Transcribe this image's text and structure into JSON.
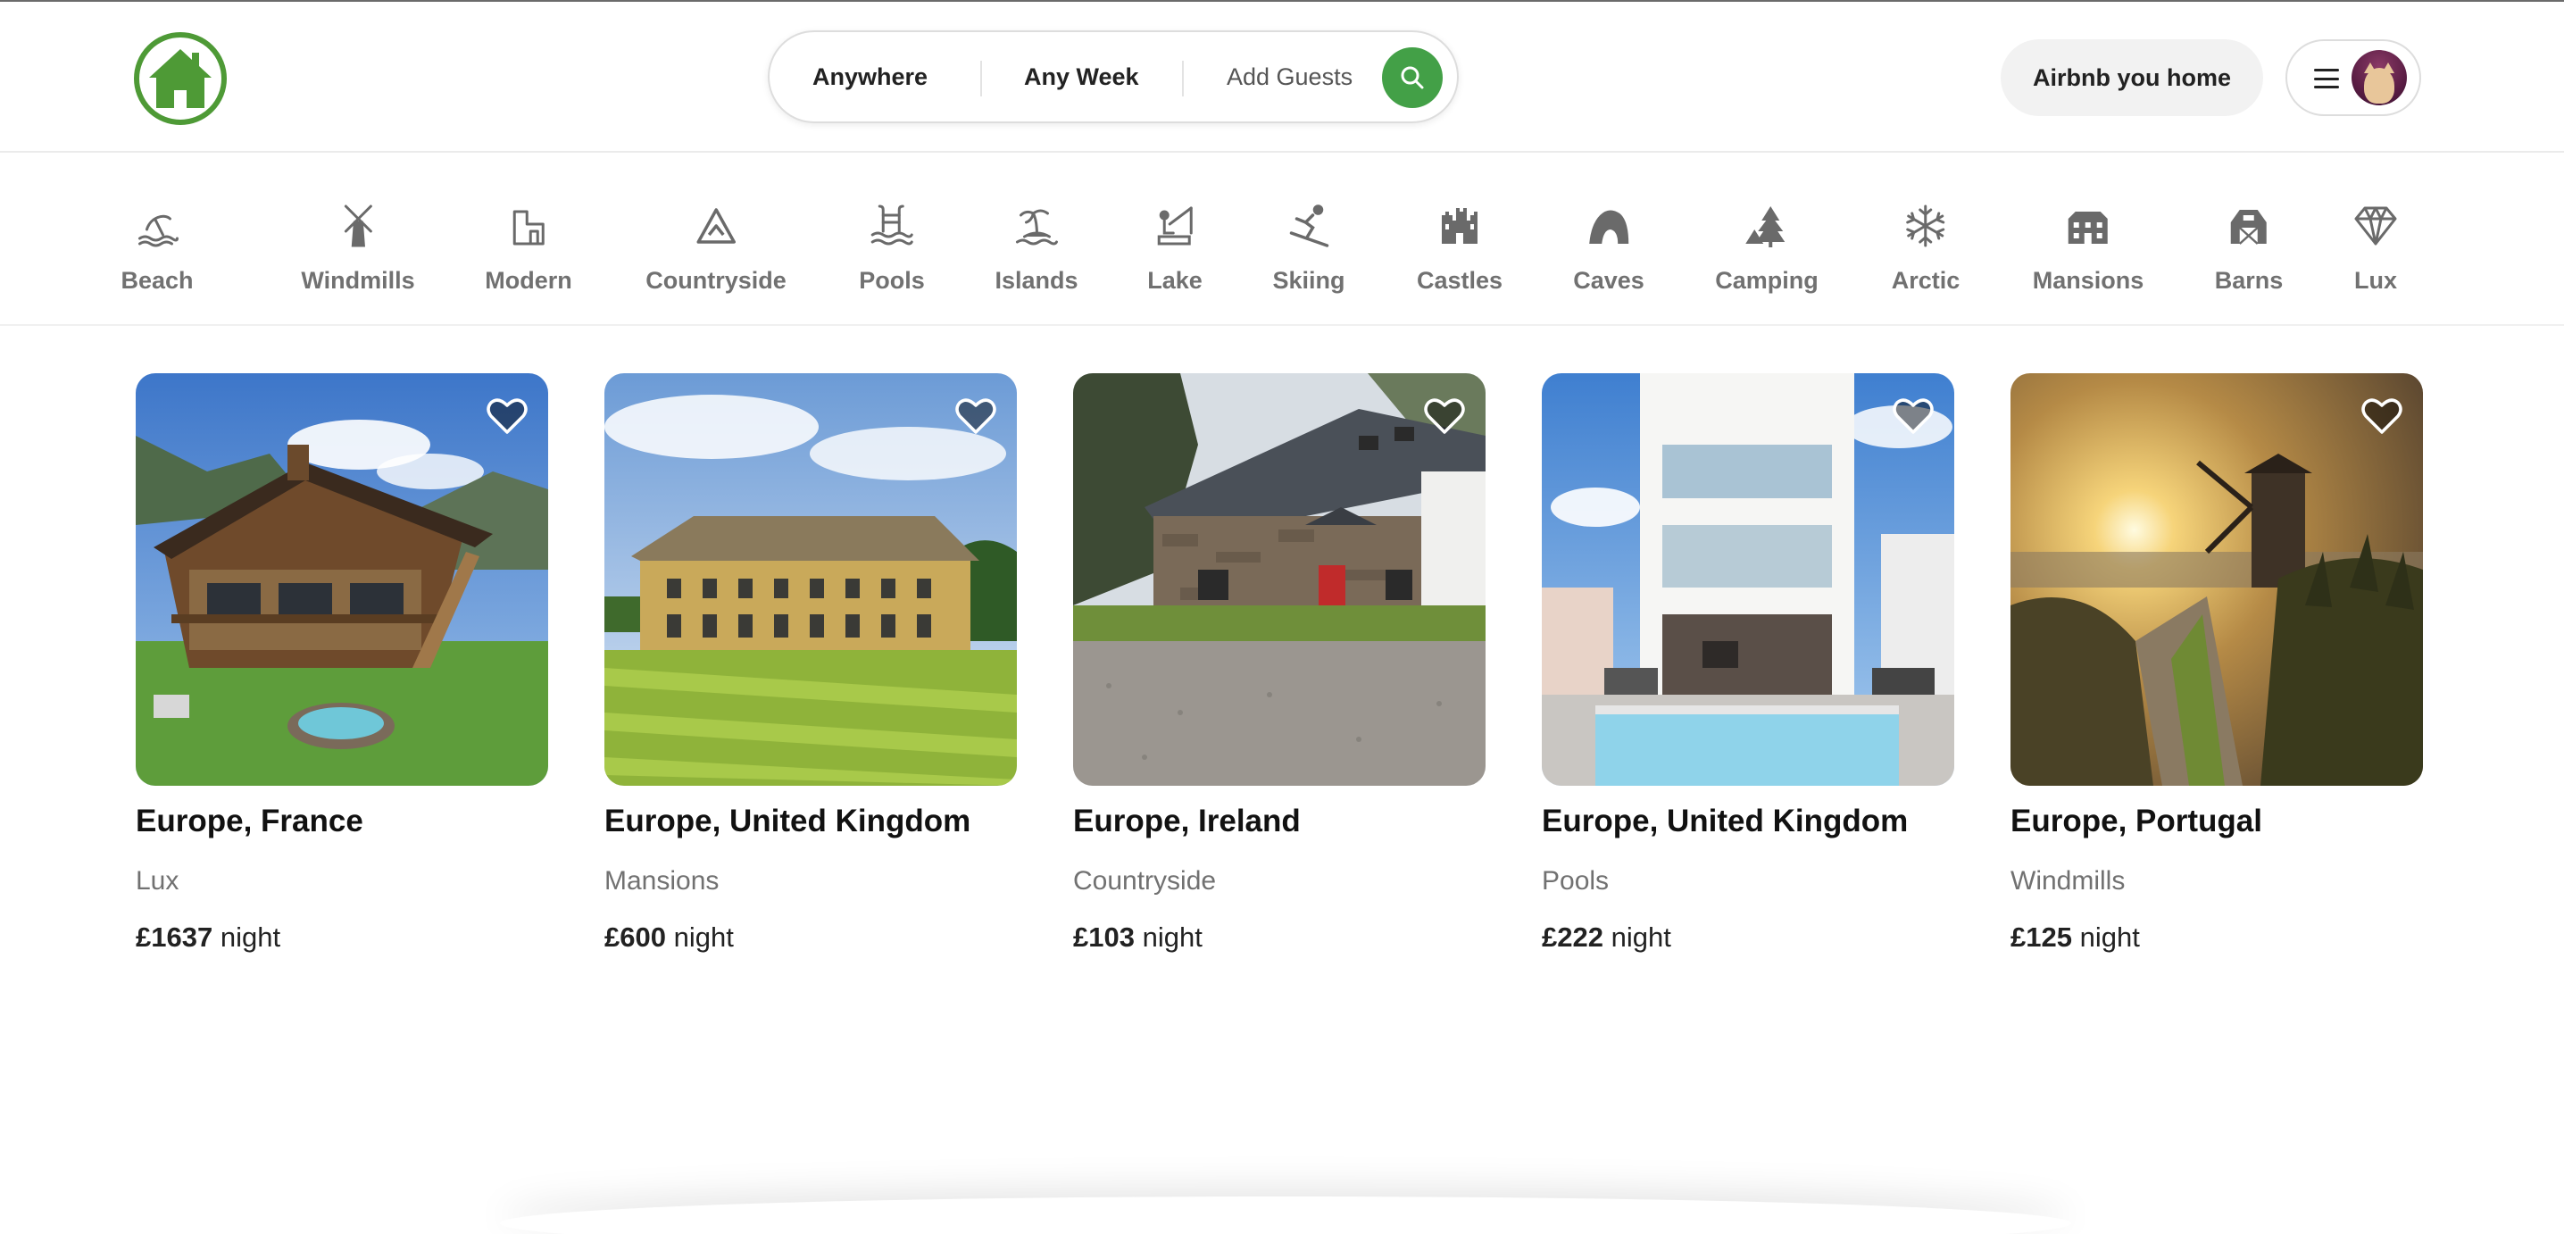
{
  "header": {
    "search": {
      "location": "Anywhere",
      "week": "Any Week",
      "guests": "Add Guests"
    },
    "host_button": "Airbnb you home"
  },
  "categories": [
    {
      "label": "Beach",
      "icon": "beach-icon"
    },
    {
      "label": "Windmills",
      "icon": "windmill-icon"
    },
    {
      "label": "Modern",
      "icon": "modern-building-icon"
    },
    {
      "label": "Countryside",
      "icon": "mountain-icon"
    },
    {
      "label": "Pools",
      "icon": "pool-icon"
    },
    {
      "label": "Islands",
      "icon": "island-icon"
    },
    {
      "label": "Lake",
      "icon": "fishing-icon"
    },
    {
      "label": "Skiing",
      "icon": "skiing-icon"
    },
    {
      "label": "Castles",
      "icon": "castle-icon"
    },
    {
      "label": "Caves",
      "icon": "cave-icon"
    },
    {
      "label": "Camping",
      "icon": "camping-icon"
    },
    {
      "label": "Arctic",
      "icon": "snowflake-icon"
    },
    {
      "label": "Mansions",
      "icon": "mansion-icon"
    },
    {
      "label": "Barns",
      "icon": "barn-icon"
    },
    {
      "label": "Lux",
      "icon": "diamond-icon"
    }
  ],
  "listings": [
    {
      "location": "Europe, France",
      "type": "Lux",
      "price": "£1637",
      "unit": "night"
    },
    {
      "location": "Europe, United Kingdom",
      "type": "Mansions",
      "price": "£600",
      "unit": "night"
    },
    {
      "location": "Europe, Ireland",
      "type": "Countryside",
      "price": "£103",
      "unit": "night"
    },
    {
      "location": "Europe, United Kingdom",
      "type": "Pools",
      "price": "£222",
      "unit": "night"
    },
    {
      "location": "Europe, Portugal",
      "type": "Windmills",
      "price": "£125",
      "unit": "night"
    }
  ],
  "colors": {
    "brand_green": "#43a047",
    "logo_green": "#4e9a36",
    "category_text": "#717171"
  }
}
